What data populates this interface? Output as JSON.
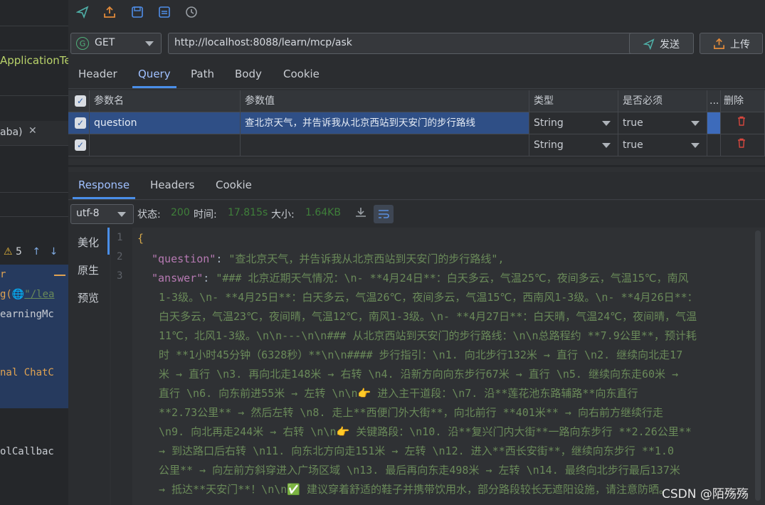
{
  "left": {
    "app_test": "ApplicationTe",
    "tab_label": "aba)",
    "warnings": "5",
    "code_lines": [
      "r",
      "g(",
      "\"/lea",
      "earningMc",
      "nal ChatC",
      "olCallbac"
    ]
  },
  "toolbar": {
    "icons": [
      "send-icon",
      "upload-icon",
      "save-icon",
      "save-as-icon",
      "history-icon"
    ]
  },
  "request": {
    "method": "GET",
    "method_badge": "G",
    "url": "http://localhost:8088/learn/mcp/ask",
    "send_label": "发送",
    "upload_label": "上传"
  },
  "req_tabs": [
    "Header",
    "Query",
    "Path",
    "Body",
    "Cookie"
  ],
  "params": {
    "headers": {
      "name": "参数名",
      "value": "参数值",
      "type": "类型",
      "required": "是否必须",
      "more": "...",
      "delete": "删除"
    },
    "rows": [
      {
        "name": "question",
        "value": "查北京天气，并告诉我从北京西站到天安门的步行路线",
        "type": "String",
        "required": "true"
      },
      {
        "name": "",
        "value": "",
        "type": "String",
        "required": "true"
      }
    ]
  },
  "resp_tabs": [
    "Response",
    "Headers",
    "Cookie"
  ],
  "resp": {
    "encoding": "utf-8",
    "status_label": "状态:",
    "status": "200",
    "time_label": "时间:",
    "time": "17.815s",
    "size_label": "大小:",
    "size": "1.64KB"
  },
  "view_modes": [
    "美化",
    "原生",
    "预览"
  ],
  "line_numbers": [
    "1",
    "2",
    "3"
  ],
  "json_lines": {
    "l1": "{",
    "q_key": "\"question\"",
    "q_val": "\"查北京天气，并告诉我从北京西站到天安门的步行路线\",",
    "a_key": "\"answer\"",
    "a_lines": [
      "\"### 北京近期天气情况：\\n- **4月24日**：白天多云，气温25℃，夜间多云，气温15℃，南风",
      "1-3级。\\n- **4月25日**：白天多云，气温26℃，夜间多云，气温15℃，西南风1-3级。\\n- **4月26日**：",
      "白天多云，气温23℃，夜间晴，气温12℃，南风1-3级。\\n- **4月27日**：白天晴，气温24℃，夜间晴，气温",
      "11℃，北风1-3级。\\n\\n---\\n\\n### 从北京西站到天安门的步行路线：\\n\\n总路程约 **7.9公里**，预计耗",
      "时 **1小时45分钟（6328秒）**\\n\\n#### 步行指引：\\n1. 向北步行132米 → 直行  \\n2. 继续向北走17",
      "米 → 直行  \\n3. 再向北走148米 → 右转  \\n4. 沿新方向向东步行67米 → 直行  \\n5. 继续向东走60米 →",
      " 直行  \\n6. 向东前进55米 → 左转  \\n\\n👉 进入主干道段：\\n7. 沿**莲花池东路辅路**向东直行",
      "**2.73公里** → 然后左转  \\n8. 走上**西便门外大街**，向北前行 **401米** → 向右前方继续行走",
      "\\n9. 向北再走244米 → 右转  \\n\\n👉 关键路段：\\n10. 沿**复兴门内大街**一路向东步行 **2.26公里**",
      " → 到达路口后右转  \\n11. 向东北方向走151米 → 左转  \\n12. 进入**西长安街**，继续向东步行 **1.0",
      "公里** → 向左前方斜穿进入广场区域  \\n13. 最后再向东走498米 → 左转  \\n14. 最终向北步行最后137米",
      " → 抵达**天安门**！\\n\\n✅ 建议穿着舒适的鞋子并携带饮用水，部分路段较长无遮阳设施，请注意防晒。"
    ]
  },
  "watermark": "CSDN @陌殇殇"
}
